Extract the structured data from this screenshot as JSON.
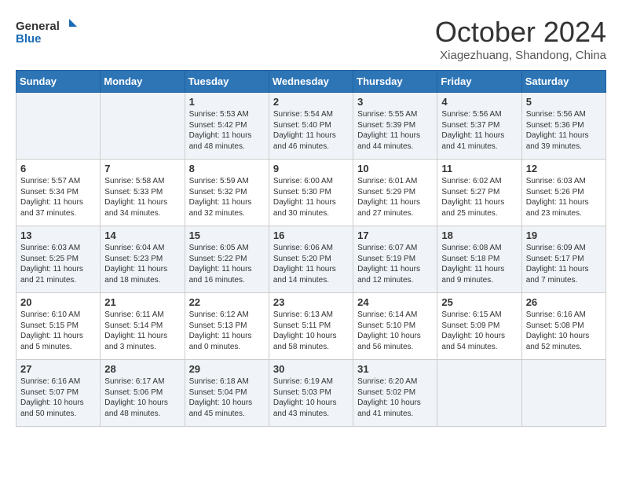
{
  "header": {
    "logo_general": "General",
    "logo_blue": "Blue",
    "month_title": "October 2024",
    "subtitle": "Xiagezhuang, Shandong, China"
  },
  "weekdays": [
    "Sunday",
    "Monday",
    "Tuesday",
    "Wednesday",
    "Thursday",
    "Friday",
    "Saturday"
  ],
  "weeks": [
    [
      {
        "day": "",
        "sunrise": "",
        "sunset": "",
        "daylight": ""
      },
      {
        "day": "",
        "sunrise": "",
        "sunset": "",
        "daylight": ""
      },
      {
        "day": "1",
        "sunrise": "Sunrise: 5:53 AM",
        "sunset": "Sunset: 5:42 PM",
        "daylight": "Daylight: 11 hours and 48 minutes."
      },
      {
        "day": "2",
        "sunrise": "Sunrise: 5:54 AM",
        "sunset": "Sunset: 5:40 PM",
        "daylight": "Daylight: 11 hours and 46 minutes."
      },
      {
        "day": "3",
        "sunrise": "Sunrise: 5:55 AM",
        "sunset": "Sunset: 5:39 PM",
        "daylight": "Daylight: 11 hours and 44 minutes."
      },
      {
        "day": "4",
        "sunrise": "Sunrise: 5:56 AM",
        "sunset": "Sunset: 5:37 PM",
        "daylight": "Daylight: 11 hours and 41 minutes."
      },
      {
        "day": "5",
        "sunrise": "Sunrise: 5:56 AM",
        "sunset": "Sunset: 5:36 PM",
        "daylight": "Daylight: 11 hours and 39 minutes."
      }
    ],
    [
      {
        "day": "6",
        "sunrise": "Sunrise: 5:57 AM",
        "sunset": "Sunset: 5:34 PM",
        "daylight": "Daylight: 11 hours and 37 minutes."
      },
      {
        "day": "7",
        "sunrise": "Sunrise: 5:58 AM",
        "sunset": "Sunset: 5:33 PM",
        "daylight": "Daylight: 11 hours and 34 minutes."
      },
      {
        "day": "8",
        "sunrise": "Sunrise: 5:59 AM",
        "sunset": "Sunset: 5:32 PM",
        "daylight": "Daylight: 11 hours and 32 minutes."
      },
      {
        "day": "9",
        "sunrise": "Sunrise: 6:00 AM",
        "sunset": "Sunset: 5:30 PM",
        "daylight": "Daylight: 11 hours and 30 minutes."
      },
      {
        "day": "10",
        "sunrise": "Sunrise: 6:01 AM",
        "sunset": "Sunset: 5:29 PM",
        "daylight": "Daylight: 11 hours and 27 minutes."
      },
      {
        "day": "11",
        "sunrise": "Sunrise: 6:02 AM",
        "sunset": "Sunset: 5:27 PM",
        "daylight": "Daylight: 11 hours and 25 minutes."
      },
      {
        "day": "12",
        "sunrise": "Sunrise: 6:03 AM",
        "sunset": "Sunset: 5:26 PM",
        "daylight": "Daylight: 11 hours and 23 minutes."
      }
    ],
    [
      {
        "day": "13",
        "sunrise": "Sunrise: 6:03 AM",
        "sunset": "Sunset: 5:25 PM",
        "daylight": "Daylight: 11 hours and 21 minutes."
      },
      {
        "day": "14",
        "sunrise": "Sunrise: 6:04 AM",
        "sunset": "Sunset: 5:23 PM",
        "daylight": "Daylight: 11 hours and 18 minutes."
      },
      {
        "day": "15",
        "sunrise": "Sunrise: 6:05 AM",
        "sunset": "Sunset: 5:22 PM",
        "daylight": "Daylight: 11 hours and 16 minutes."
      },
      {
        "day": "16",
        "sunrise": "Sunrise: 6:06 AM",
        "sunset": "Sunset: 5:20 PM",
        "daylight": "Daylight: 11 hours and 14 minutes."
      },
      {
        "day": "17",
        "sunrise": "Sunrise: 6:07 AM",
        "sunset": "Sunset: 5:19 PM",
        "daylight": "Daylight: 11 hours and 12 minutes."
      },
      {
        "day": "18",
        "sunrise": "Sunrise: 6:08 AM",
        "sunset": "Sunset: 5:18 PM",
        "daylight": "Daylight: 11 hours and 9 minutes."
      },
      {
        "day": "19",
        "sunrise": "Sunrise: 6:09 AM",
        "sunset": "Sunset: 5:17 PM",
        "daylight": "Daylight: 11 hours and 7 minutes."
      }
    ],
    [
      {
        "day": "20",
        "sunrise": "Sunrise: 6:10 AM",
        "sunset": "Sunset: 5:15 PM",
        "daylight": "Daylight: 11 hours and 5 minutes."
      },
      {
        "day": "21",
        "sunrise": "Sunrise: 6:11 AM",
        "sunset": "Sunset: 5:14 PM",
        "daylight": "Daylight: 11 hours and 3 minutes."
      },
      {
        "day": "22",
        "sunrise": "Sunrise: 6:12 AM",
        "sunset": "Sunset: 5:13 PM",
        "daylight": "Daylight: 11 hours and 0 minutes."
      },
      {
        "day": "23",
        "sunrise": "Sunrise: 6:13 AM",
        "sunset": "Sunset: 5:11 PM",
        "daylight": "Daylight: 10 hours and 58 minutes."
      },
      {
        "day": "24",
        "sunrise": "Sunrise: 6:14 AM",
        "sunset": "Sunset: 5:10 PM",
        "daylight": "Daylight: 10 hours and 56 minutes."
      },
      {
        "day": "25",
        "sunrise": "Sunrise: 6:15 AM",
        "sunset": "Sunset: 5:09 PM",
        "daylight": "Daylight: 10 hours and 54 minutes."
      },
      {
        "day": "26",
        "sunrise": "Sunrise: 6:16 AM",
        "sunset": "Sunset: 5:08 PM",
        "daylight": "Daylight: 10 hours and 52 minutes."
      }
    ],
    [
      {
        "day": "27",
        "sunrise": "Sunrise: 6:16 AM",
        "sunset": "Sunset: 5:07 PM",
        "daylight": "Daylight: 10 hours and 50 minutes."
      },
      {
        "day": "28",
        "sunrise": "Sunrise: 6:17 AM",
        "sunset": "Sunset: 5:06 PM",
        "daylight": "Daylight: 10 hours and 48 minutes."
      },
      {
        "day": "29",
        "sunrise": "Sunrise: 6:18 AM",
        "sunset": "Sunset: 5:04 PM",
        "daylight": "Daylight: 10 hours and 45 minutes."
      },
      {
        "day": "30",
        "sunrise": "Sunrise: 6:19 AM",
        "sunset": "Sunset: 5:03 PM",
        "daylight": "Daylight: 10 hours and 43 minutes."
      },
      {
        "day": "31",
        "sunrise": "Sunrise: 6:20 AM",
        "sunset": "Sunset: 5:02 PM",
        "daylight": "Daylight: 10 hours and 41 minutes."
      },
      {
        "day": "",
        "sunrise": "",
        "sunset": "",
        "daylight": ""
      },
      {
        "day": "",
        "sunrise": "",
        "sunset": "",
        "daylight": ""
      }
    ]
  ]
}
